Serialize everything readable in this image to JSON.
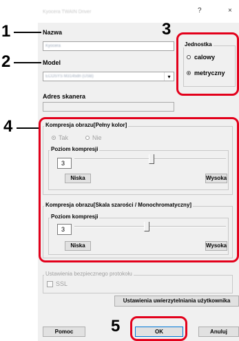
{
  "window": {
    "title": "Kyocera TWAIN Driver",
    "help_glyph": "?",
    "close_glyph": "×"
  },
  "callouts": [
    "1",
    "2",
    "3",
    "4",
    "5"
  ],
  "fields": {
    "name_label": "Nazwa",
    "name_value": "Kyocera",
    "model_label": "Model",
    "model_value": "ECOSYS M3145dn (USB)",
    "scanner_address_label": "Adres skanera"
  },
  "units": {
    "title": "Jednostka",
    "options": [
      "calowy",
      "metryczny"
    ],
    "selected": "metryczny"
  },
  "color_compression": {
    "title": "Kompresja obrazu[Pełny kolor]",
    "options": [
      "Tak",
      "Nie"
    ],
    "level_title": "Poziom kompresji",
    "level": "3",
    "low_label": "Niska",
    "high_label": "Wysoka"
  },
  "gray_compression": {
    "title": "Kompresja obrazu[Skala szarości / Monochromatyczny]",
    "level_title": "Poziom kompresji",
    "level": "3",
    "low_label": "Niska",
    "high_label": "Wysoka"
  },
  "secure_protocol": {
    "title": "Ustawienia bezpiecznego protokołu",
    "ssl_label": "SSL"
  },
  "buttons": {
    "auth_settings": "Ustawienia uwierzytelniania użytkownika",
    "help": "Pomoc",
    "ok": "OK",
    "cancel": "Anuluj"
  }
}
